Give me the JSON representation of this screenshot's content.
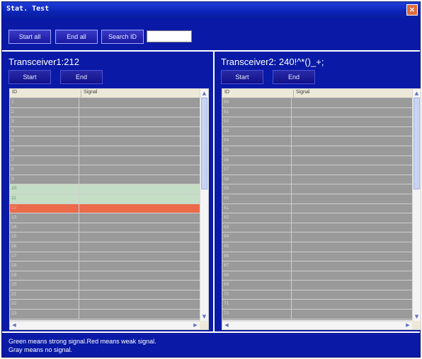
{
  "window": {
    "title": "Stat. Test"
  },
  "toolbar": {
    "start_all_label": "Start all",
    "end_all_label": "End all",
    "search_id_label": "Search ID",
    "search_value": ""
  },
  "transceiver1": {
    "title": "Transceiver1:212",
    "start_label": "Start",
    "end_label": "End",
    "columns": [
      "ID",
      "Signal"
    ],
    "rows": [
      "1",
      "2",
      "3",
      "4",
      "5",
      "6",
      "7",
      "8",
      "9",
      "10",
      "11",
      "12",
      "13",
      "14",
      "15",
      "16",
      "17",
      "18",
      "19",
      "20",
      "21",
      "22",
      "23"
    ],
    "row_status": [
      "gray",
      "gray",
      "gray",
      "gray",
      "gray",
      "gray",
      "gray",
      "gray",
      "gray",
      "green",
      "green",
      "red",
      "gray",
      "gray",
      "gray",
      "gray",
      "gray",
      "gray",
      "gray",
      "gray",
      "gray",
      "gray",
      "gray"
    ]
  },
  "transceiver2": {
    "title": "Transceiver2: 240!^*()_+;",
    "start_label": "Start",
    "end_label": "End",
    "columns": [
      "ID",
      "Signal"
    ],
    "rows": [
      "50",
      "51",
      "52",
      "53",
      "54",
      "55",
      "56",
      "57",
      "58",
      "59",
      "60",
      "61",
      "62",
      "63",
      "64",
      "65",
      "66",
      "67",
      "68",
      "69",
      "70",
      "71",
      "72"
    ],
    "row_status": [
      "gray",
      "gray",
      "gray",
      "gray",
      "gray",
      "gray",
      "gray",
      "gray",
      "gray",
      "gray",
      "gray",
      "gray",
      "gray",
      "gray",
      "gray",
      "gray",
      "gray",
      "gray",
      "gray",
      "gray",
      "gray",
      "gray",
      "gray"
    ]
  },
  "status": {
    "line1": "Green means strong signal.Red means weak signal.",
    "line2": "Gray means no signal."
  },
  "colors": {
    "background": "#0a1aa6",
    "strong": "#c4ddc4",
    "weak": "#ea6a4a",
    "none": "#9a9a9a"
  }
}
